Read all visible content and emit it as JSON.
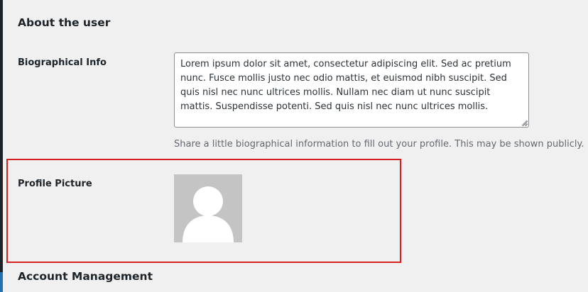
{
  "about": {
    "title": "About the user"
  },
  "bio": {
    "label": "Biographical Info",
    "value": "Lorem ipsum dolor sit amet, consectetur adipiscing elit. Sed ac pretium nunc. Fusce mollis justo nec odio mattis, et euismod nibh suscipit. Sed quis nisl nec nunc ultrices mollis. Nullam nec diam ut nunc suscipit mattis. Suspendisse potenti. Sed quis nisl nec nunc ultrices mollis.",
    "help": "Share a little biographical information to fill out your profile. This may be shown publicly."
  },
  "profile_picture": {
    "label": "Profile Picture",
    "avatar_icon": "default-user-silhouette-icon",
    "highlight_color": "#d61f1f"
  },
  "account": {
    "title": "Account Management"
  },
  "colors": {
    "background": "#f0f0f1",
    "help_text": "#646970",
    "avatar_bg": "#c4c4c4"
  }
}
